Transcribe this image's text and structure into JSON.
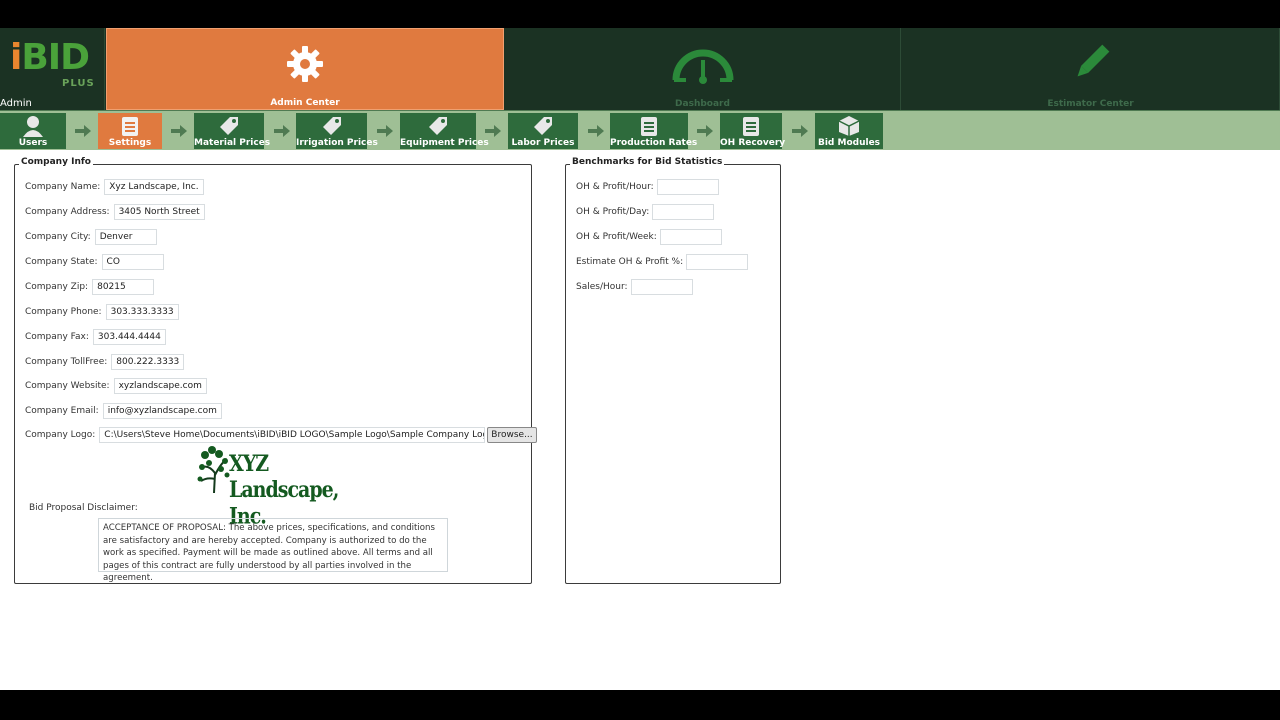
{
  "header": {
    "brand_i": "i",
    "brand_bid": "BID",
    "brand_plus": "PLUS",
    "user": "Admin",
    "tabs": {
      "admin": "Admin Center",
      "dashboard": "Dashboard",
      "estimator": "Estimator Center"
    },
    "active_tab": "Admin Center"
  },
  "subnav": {
    "items": [
      "Users",
      "Settings",
      "Material Prices",
      "Irrigation Prices",
      "Equipment Prices",
      "Labor Prices",
      "Production Rates",
      "OH Recovery",
      "Bid Modules"
    ],
    "active": "Settings"
  },
  "company_info": {
    "legend": "Company Info",
    "fields": {
      "name": {
        "label": "Company Name:",
        "value": "Xyz Landscape, Inc."
      },
      "address": {
        "label": "Company Address:",
        "value": "3405 North Street"
      },
      "city": {
        "label": "Company City:",
        "value": "Denver"
      },
      "state": {
        "label": "Company State:",
        "value": "CO"
      },
      "zip": {
        "label": "Company Zip:",
        "value": "80215"
      },
      "phone": {
        "label": "Company Phone:",
        "value": "303.333.3333"
      },
      "fax": {
        "label": "Company Fax:",
        "value": "303.444.4444"
      },
      "tollfree": {
        "label": "Company TollFree:",
        "value": "800.222.3333"
      },
      "website": {
        "label": "Company Website:",
        "value": "xyzlandscape.com"
      },
      "email": {
        "label": "Company Email:",
        "value": "info@xyzlandscape.com"
      },
      "logo": {
        "label": "Company Logo:",
        "value": "C:\\Users\\Steve Home\\Documents\\iBID\\iBID LOGO\\Sample Logo\\Sample Company Logo .jpg"
      }
    },
    "browse_label": "Browse...",
    "logo_wordmark": "XYZ Landscape, Inc.",
    "disclaimer_label": "Bid Proposal Disclaimer:",
    "disclaimer_text": "ACCEPTANCE OF PROPOSAL:  The above prices, specifications, and conditions are satisfactory and are hereby accepted.  Company is authorized to do the work as specified.  Payment will be made as outlined above.  All terms and all pages of this contract are fully understood by all parties involved in the agreement."
  },
  "benchmarks": {
    "legend": "Benchmarks for Bid Statistics",
    "fields": {
      "oh_hour": {
        "label": "OH & Profit/Hour:",
        "value": ""
      },
      "oh_day": {
        "label": "OH & Profit/Day:",
        "value": ""
      },
      "oh_week": {
        "label": "OH & Profit/Week:",
        "value": ""
      },
      "estimate_pct": {
        "label": "Estimate OH & Profit %:",
        "value": ""
      },
      "sales_hour": {
        "label": "Sales/Hour:",
        "value": ""
      }
    }
  },
  "colors": {
    "header_bg": "#1b3223",
    "active_orange": "#e07a3f",
    "subnav_bg": "#9fbf95",
    "subnav_item": "#2e6b3c"
  }
}
